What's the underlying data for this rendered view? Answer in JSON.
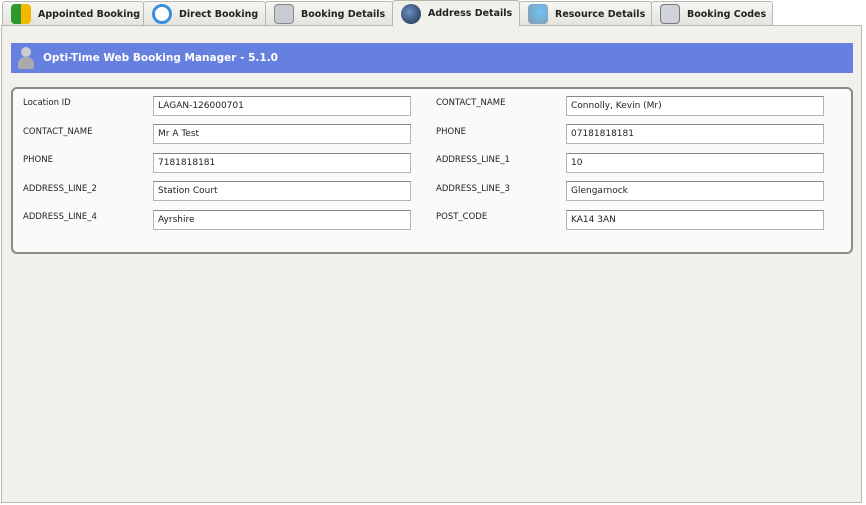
{
  "tabs": [
    {
      "label": "Appointed Booking",
      "icon": "grid-icon",
      "color": "#2e9a2e"
    },
    {
      "label": "Direct Booking",
      "icon": "clock-icon",
      "color": "#3a8fd8"
    },
    {
      "label": "Booking Details",
      "icon": "document-search-icon",
      "color": "#9aa0a8"
    },
    {
      "label": "Address Details",
      "icon": "globe-pin-icon",
      "color": "#2c4a7a"
    },
    {
      "label": "Resource Details",
      "icon": "users-icon",
      "color": "#4aa8e8"
    },
    {
      "label": "Booking Codes",
      "icon": "document-icon",
      "color": "#8898aa"
    }
  ],
  "active_tab": "Address Details",
  "header": {
    "title": "Opti-Time Web Booking Manager - 5.1.0"
  },
  "fields_left": [
    {
      "label": "Location ID",
      "value": "LAGAN-126000701"
    },
    {
      "label": "CONTACT_NAME",
      "value": "Mr A Test"
    },
    {
      "label": "PHONE",
      "value": "7181818181"
    },
    {
      "label": "ADDRESS_LINE_2",
      "value": "Station Court"
    },
    {
      "label": "ADDRESS_LINE_4",
      "value": "Ayrshire"
    }
  ],
  "fields_right": [
    {
      "label": "CONTACT_NAME",
      "value": "Connolly, Kevin (Mr)"
    },
    {
      "label": "PHONE",
      "value": "07181818181"
    },
    {
      "label": "ADDRESS_LINE_1",
      "value": "10"
    },
    {
      "label": "ADDRESS_LINE_3",
      "value": "Glengarnock"
    },
    {
      "label": "POST_CODE",
      "value": "KA14 3AN"
    }
  ]
}
